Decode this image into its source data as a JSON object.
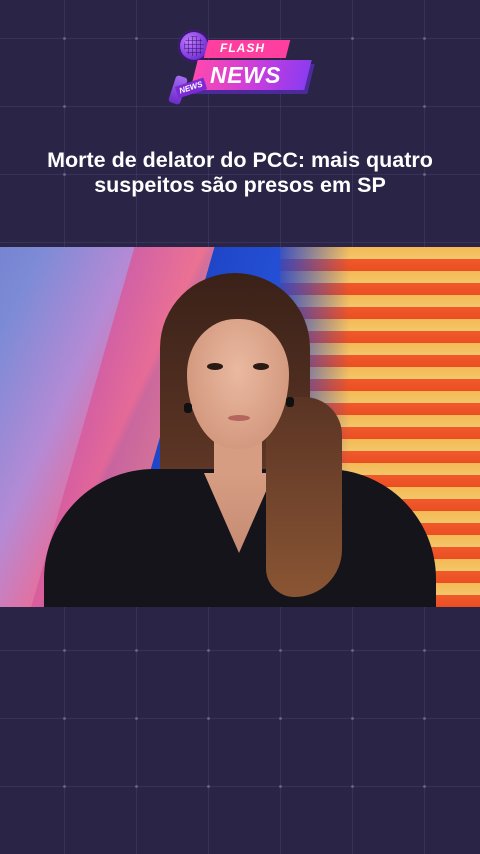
{
  "logo": {
    "flash_label": "FLASH",
    "news_label": "NEWS",
    "mic_tag": "NEWS"
  },
  "headline": {
    "text": "Morte de delator do PCC: mais quatro suspeitos são presos em SP"
  },
  "colors": {
    "background": "#2a2447",
    "accent_pink": "#ff3fa0",
    "accent_purple": "#8b3cf0",
    "headline_text": "#ffffff"
  }
}
